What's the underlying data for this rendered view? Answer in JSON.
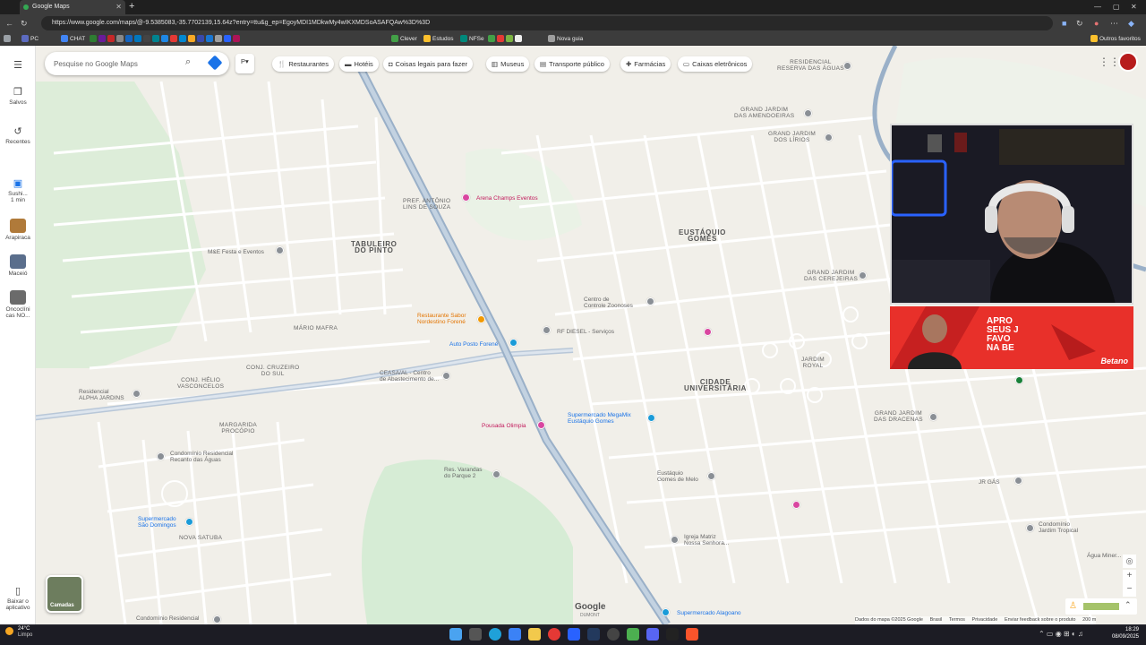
{
  "browser": {
    "tab_title": "Google Maps",
    "url": "https://www.google.com/maps/@-9.5385083,-35.7702139,15.64z?entry=ttu&g_ep=EgoyMDI1MDkwMy4wIKXMDSoASAFQAw%3D%3D",
    "bookmarks": [
      "PC",
      "CHAT",
      "Clever",
      "Estudos",
      "NFSe",
      "Nova guia"
    ],
    "other_bookmarks": "Outros favoritos"
  },
  "maps": {
    "search_placeholder": "Pesquise no Google Maps",
    "chips": [
      "Restaurantes",
      "Hotéis",
      "Coisas legais para fazer",
      "Museus",
      "Transporte público",
      "Farmácias",
      "Caixas eletrônicos"
    ],
    "rail": {
      "saved": "Salvos",
      "recent": "Recentes",
      "sushi": "Sushi...",
      "sushi_time": "1 min",
      "arapiraca": "Arapiraca",
      "maceio": "Maceió",
      "oncoclinicas": "Oncoclíni cas NO...",
      "download": "Baixar o aplicativo"
    },
    "layers_label": "Camadas",
    "logo": "Google",
    "logo_sub": "DUMONT",
    "attribution": [
      "Dados do mapa ©2025 Google",
      "Brasil",
      "Termos",
      "Privacidade",
      "Enviar feedback sobre o produto",
      "200 m"
    ],
    "labels": {
      "residencial_reserva": "Residencial\nReserva das Águas",
      "grand_amendoeiras": "GRAND JARDIM\nDAS AMENDOEIRAS",
      "grand_lirios": "GRAND JARDIM\nDOS LÍRIOS",
      "arena_champs": "Arena Champs Eventos",
      "pref_antonio": "PREF. ANTÔNIO\nLINS DE SOUZA",
      "eustaquio_gomes": "EUSTÁQUIO\nGOMES",
      "tabuleiro": "TABULEIRO\nDO PINTO",
      "me_festa": "M&E Festa e Eventos",
      "grand_cerejeiras": "GRAND JARDIM\nDAS CEREJEIRAS",
      "centro_zoonoses": "Centro de\nControle Zoonoses",
      "restaurante_sabor": "Restaurante Sabor\nNordestino Forené",
      "rf_diesel": "RF DIESEL - Serviços",
      "auto_posto": "Auto Posto Forené",
      "mario_mafra": "MÁRIO MAFRA",
      "jardim_royal": "JARDIM\nROYAL",
      "conj_cruzeiro": "CONJ. CRUZEIRO\nDO SUL",
      "conj_helio": "CONJ. HÉLIO\nVASCONCELOS",
      "ceasa": "CEASA/AL - Centro\nde Abastecimento de...",
      "cidade_univ": "CIDADE\nUNIVERSITÁRIA",
      "residencial_alpha": "Residencial\nALPHA JARDINS",
      "supermercado_megamix": "Supermercado MegaMix\nEustáquio Gomes",
      "pousada_olimpia": "Pousada Olimpia",
      "grand_dracenas": "GRAND JARDIM\nDAS DRACENAS",
      "margarida": "MARGARIDA\nPROCÓPIO",
      "condominio_recanto": "Condomínio Residencial\nRecanto das Águas",
      "res_varandas": "Res. Varandas\ndo Parque 2",
      "eustaquio_melo": "Eustáquio\nGomes de Melo",
      "jr_gas": "JR GÁS",
      "condominio_jardim": "Condomínio\nJardim Tropical",
      "supermercado_sao": "Supermercado\nSão Domingos",
      "nova_satuba": "NOVA SATUBA",
      "igreja_matriz": "Igreja Matriz\nNossa Senhora...",
      "agua_mineral": "Água Miner...",
      "supermercado_alagoano": "Supermercado Alagoano",
      "condominio_residencial": "Condomínio Residencial"
    }
  },
  "ad": {
    "text": "APRO\nSEUS J\nFAVO\nNA BE",
    "brand": "Betano"
  },
  "taskbar": {
    "temperature": "24°C",
    "weather": "Limpo",
    "time": "18:29",
    "date": "08/09/2025"
  },
  "colors": {
    "map_bg": "#f1efe9",
    "road": "#ffffff",
    "highway": "#9ab0c8",
    "green_area": "#c8e6c9",
    "ad_red": "#e8302a"
  }
}
